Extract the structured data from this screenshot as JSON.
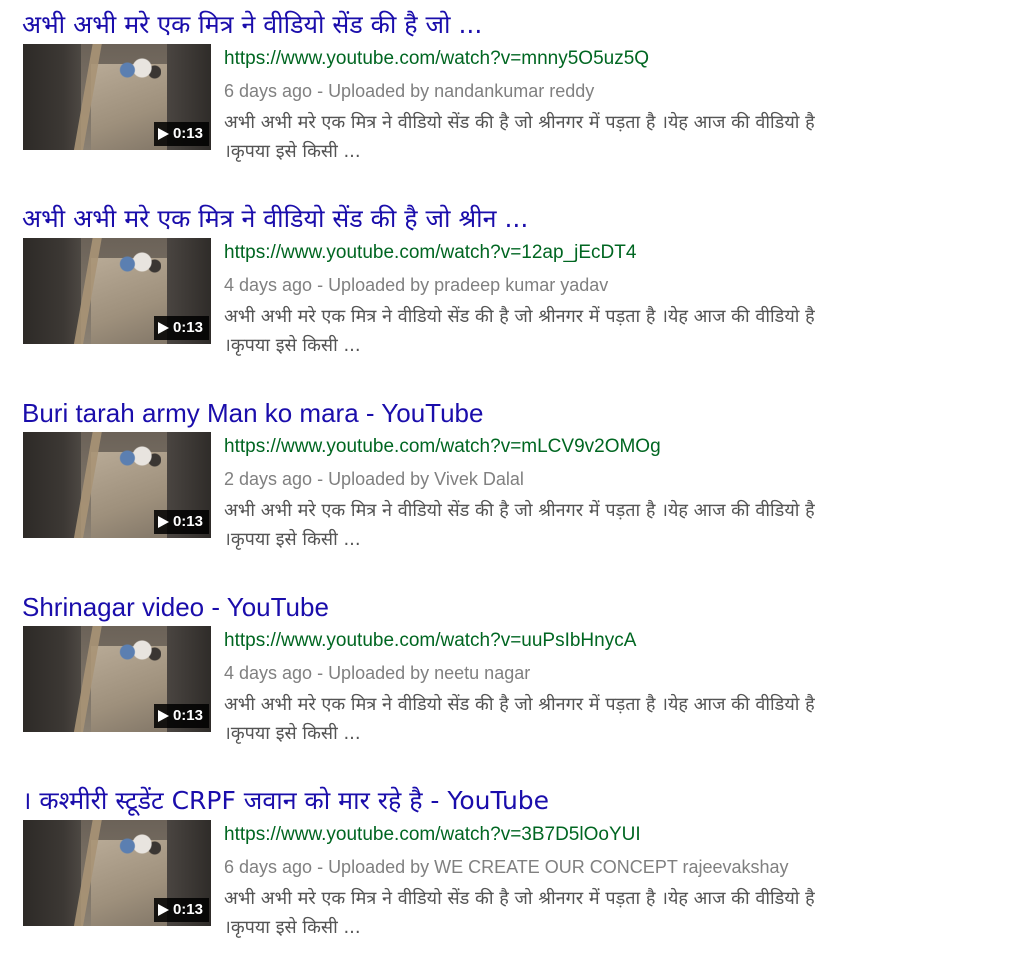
{
  "results": [
    {
      "title": "अभी अभी मरे एक मित्र ने वीडियो सेंड की है जो ...",
      "url": "https://www.youtube.com/watch?v=mnny5O5uz5Q",
      "meta": "6 days ago - Uploaded by nandankumar reddy",
      "snippet_line1": "अभी अभी मरे एक मित्र ने वीडियो सेंड की है जो श्रीनगर में पड़ता है ।येह आज की वीडियो है",
      "snippet_line2": "।कृपया इसे किसी ...",
      "duration": "0:13"
    },
    {
      "title": "अभी अभी मरे एक मित्र ने वीडियो सेंड की है जो श्रीन ...",
      "url": "https://www.youtube.com/watch?v=12ap_jEcDT4",
      "meta": "4 days ago - Uploaded by pradeep kumar yadav",
      "snippet_line1": "अभी अभी मरे एक मित्र ने वीडियो सेंड की है जो श्रीनगर में पड़ता है ।येह आज की वीडियो है",
      "snippet_line2": "।कृपया इसे किसी ...",
      "duration": "0:13"
    },
    {
      "title": "Buri tarah army Man ko mara - YouTube",
      "url": "https://www.youtube.com/watch?v=mLCV9v2OMOg",
      "meta": "2 days ago - Uploaded by Vivek Dalal",
      "snippet_line1": "अभी अभी मरे एक मित्र ने वीडियो सेंड की है जो श्रीनगर में पड़ता है ।येह आज की वीडियो है",
      "snippet_line2": "।कृपया इसे किसी ...",
      "duration": "0:13"
    },
    {
      "title": "Shrinagar video - YouTube",
      "url": "https://www.youtube.com/watch?v=uuPsIbHnycA",
      "meta": "4 days ago - Uploaded by neetu nagar",
      "snippet_line1": "अभी अभी मरे एक मित्र ने वीडियो सेंड की है जो श्रीनगर में पड़ता है ।येह आज की वीडियो है",
      "snippet_line2": "।कृपया इसे किसी ...",
      "duration": "0:13"
    },
    {
      "title": "। कश्मीरी स्टूडेंट CRPF जवान को मार रहे है - YouTube",
      "url": "https://www.youtube.com/watch?v=3B7D5lOoYUI",
      "meta": "6 days ago - Uploaded by WE CREATE OUR CONCEPT rajeevakshay",
      "snippet_line1": "अभी अभी मरे एक मित्र ने वीडियो सेंड की है जो श्रीनगर में पड़ता है ।येह आज की वीडियो है",
      "snippet_line2": "।कृपया इसे किसी ...",
      "duration": "0:13"
    }
  ],
  "colors": {
    "title": "#1a0dab",
    "url": "#006621",
    "meta": "#808080",
    "snippet": "#545454"
  },
  "icons": {
    "thumbnail_overlay": "play-icon"
  }
}
